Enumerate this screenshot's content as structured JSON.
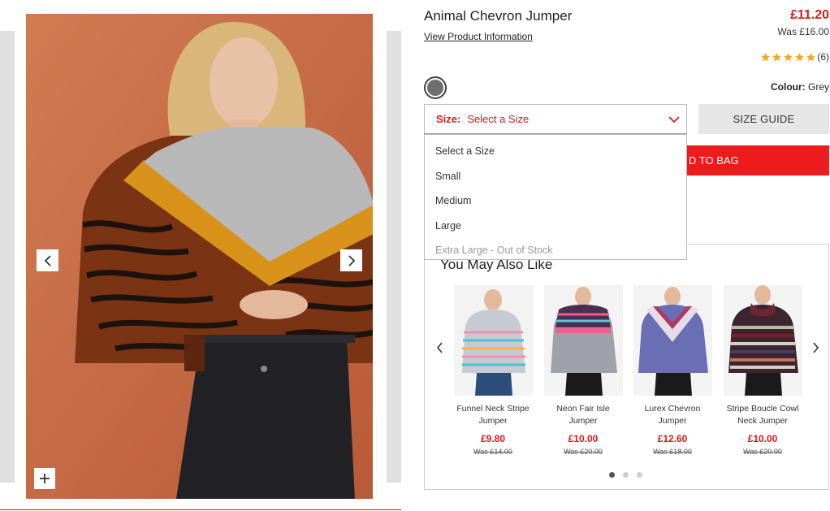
{
  "product": {
    "title": "Animal Chevron Jumper",
    "view_info_label": "View Product Information",
    "price_now": "£11.20",
    "price_was": "Was £16.00",
    "rating_stars": 5,
    "rating_count": "(6)",
    "colour_label": "Colour:",
    "colour_value": "Grey",
    "swatch_color": "#6e6e6e"
  },
  "size": {
    "label": "Size:",
    "placeholder": "Select a Size",
    "options": [
      {
        "label": "Select a Size",
        "disabled": false
      },
      {
        "label": "Small",
        "disabled": false
      },
      {
        "label": "Medium",
        "disabled": false
      },
      {
        "label": "Large",
        "disabled": false
      },
      {
        "label": "Extra Large - Out of Stock",
        "disabled": true
      }
    ]
  },
  "buttons": {
    "size_guide": "SIZE GUIDE",
    "add_to_bag": "D TO BAG"
  },
  "recommendations": {
    "title": "You May Also Like",
    "items": [
      {
        "name": "Funnel Neck Stripe Jumper",
        "price": "£9.80",
        "was": "Was £14.00",
        "icon": "striped-pastel-jumper"
      },
      {
        "name": "Neon Fair Isle Jumper",
        "price": "£10.00",
        "was": "Was £20.00",
        "icon": "fair-isle-jumper"
      },
      {
        "name": "Lurex Chevron Jumper",
        "price": "£12.60",
        "was": "Was £18.00",
        "icon": "chevron-jumper"
      },
      {
        "name": "Stripe Boucle Cowl Neck Jumper",
        "price": "£10.00",
        "was": "Was £20.00",
        "icon": "cowl-neck-jumper"
      }
    ],
    "page_count": 3,
    "active_page": 0
  },
  "colors": {
    "accent_red": "#d9191d",
    "add_bag_red": "#ec1c1c",
    "star": "#f6a623"
  }
}
